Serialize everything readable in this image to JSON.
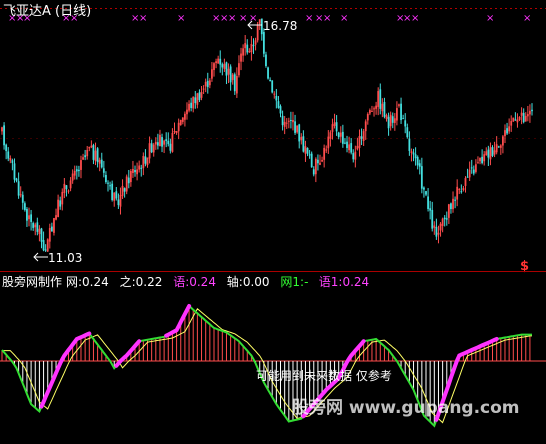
{
  "title": "飞亚达A (日线)",
  "price_high_label": "16.78",
  "price_low_label": "11.03",
  "signal_marker": "$",
  "top_markers": [
    "×",
    "×",
    "×",
    "×",
    "×",
    "×",
    "×",
    "×",
    "×",
    "×",
    "×",
    "×",
    "×",
    "×",
    "×",
    "×",
    "×",
    "×",
    "×",
    "×",
    "×",
    "×"
  ],
  "indicator_name": "股旁网制作",
  "indicator_values": [
    {
      "label": "网:0.24",
      "color": "#ffffff"
    },
    {
      "label": "之:0.22",
      "color": "#ffffff"
    },
    {
      "label": "语:0.24",
      "color": "#ff44ff"
    },
    {
      "label": "轴:0.00",
      "color": "#ffffff"
    },
    {
      "label": "网1:-",
      "color": "#33ff33"
    },
    {
      "label": "语1:0.24",
      "color": "#ff44ff"
    }
  ],
  "caption": "可能用到未来数据 仅参考",
  "watermark": "股旁网 www.gupang.com",
  "colors": {
    "up": "#ff4d4d",
    "down": "#44e0e0",
    "magenta": "#ff33ff",
    "green": "#33dd33",
    "yellow": "#ffff66",
    "red_line": "#cc0000"
  },
  "chart_data": {
    "type": "candlestick",
    "price_range": [
      11.03,
      16.78
    ],
    "price_points": [
      [
        0,
        14.0
      ],
      [
        4,
        13.3
      ],
      [
        8,
        12.6
      ],
      [
        13,
        11.8
      ],
      [
        17,
        11.6
      ],
      [
        21,
        11.03
      ],
      [
        25,
        11.9
      ],
      [
        30,
        12.6
      ],
      [
        36,
        13.0
      ],
      [
        42,
        13.6
      ],
      [
        48,
        13.2
      ],
      [
        55,
        12.2
      ],
      [
        62,
        13.0
      ],
      [
        68,
        13.3
      ],
      [
        74,
        13.9
      ],
      [
        80,
        13.6
      ],
      [
        86,
        14.4
      ],
      [
        92,
        14.8
      ],
      [
        98,
        15.2
      ],
      [
        104,
        15.9
      ],
      [
        108,
        15.6
      ],
      [
        112,
        15.2
      ],
      [
        116,
        16.2
      ],
      [
        120,
        16.1
      ],
      [
        124,
        16.78
      ],
      [
        128,
        15.5
      ],
      [
        132,
        14.8
      ],
      [
        136,
        14.2
      ],
      [
        140,
        14.3
      ],
      [
        145,
        13.7
      ],
      [
        150,
        13.1
      ],
      [
        155,
        13.6
      ],
      [
        160,
        14.2
      ],
      [
        165,
        13.8
      ],
      [
        170,
        13.4
      ],
      [
        176,
        14.5
      ],
      [
        181,
        14.9
      ],
      [
        186,
        14.2
      ],
      [
        191,
        14.7
      ],
      [
        196,
        13.6
      ],
      [
        201,
        13.0
      ],
      [
        206,
        11.9
      ],
      [
        209,
        11.4
      ],
      [
        213,
        11.8
      ],
      [
        218,
        12.5
      ],
      [
        224,
        12.9
      ],
      [
        230,
        13.3
      ],
      [
        236,
        13.6
      ],
      [
        242,
        14.0
      ],
      [
        247,
        14.5
      ],
      [
        252,
        14.3
      ],
      [
        255,
        14.6
      ]
    ],
    "indicator": {
      "range": [
        -0.5,
        0.6
      ],
      "zero_axis": 0.0,
      "points": [
        [
          0,
          0.1
        ],
        [
          7,
          -0.05
        ],
        [
          14,
          -0.3
        ],
        [
          18,
          -0.35
        ],
        [
          24,
          -0.15
        ],
        [
          30,
          0.05
        ],
        [
          36,
          0.2
        ],
        [
          42,
          0.25
        ],
        [
          48,
          0.1
        ],
        [
          54,
          -0.05
        ],
        [
          60,
          0.05
        ],
        [
          66,
          0.18
        ],
        [
          72,
          0.2
        ],
        [
          78,
          0.22
        ],
        [
          84,
          0.28
        ],
        [
          90,
          0.5
        ],
        [
          96,
          0.4
        ],
        [
          102,
          0.3
        ],
        [
          108,
          0.26
        ],
        [
          114,
          0.18
        ],
        [
          120,
          0.05
        ],
        [
          126,
          -0.15
        ],
        [
          132,
          -0.3
        ],
        [
          138,
          -0.42
        ],
        [
          144,
          -0.4
        ],
        [
          150,
          -0.3
        ],
        [
          156,
          -0.2
        ],
        [
          162,
          -0.12
        ],
        [
          168,
          0.05
        ],
        [
          174,
          0.18
        ],
        [
          180,
          0.2
        ],
        [
          186,
          0.1
        ],
        [
          192,
          -0.05
        ],
        [
          198,
          -0.2
        ],
        [
          203,
          -0.38
        ],
        [
          208,
          -0.45
        ],
        [
          214,
          -0.2
        ],
        [
          220,
          0.05
        ],
        [
          226,
          0.1
        ],
        [
          232,
          0.15
        ],
        [
          238,
          0.2
        ],
        [
          244,
          0.22
        ],
        [
          250,
          0.24
        ],
        [
          255,
          0.24
        ]
      ]
    }
  }
}
